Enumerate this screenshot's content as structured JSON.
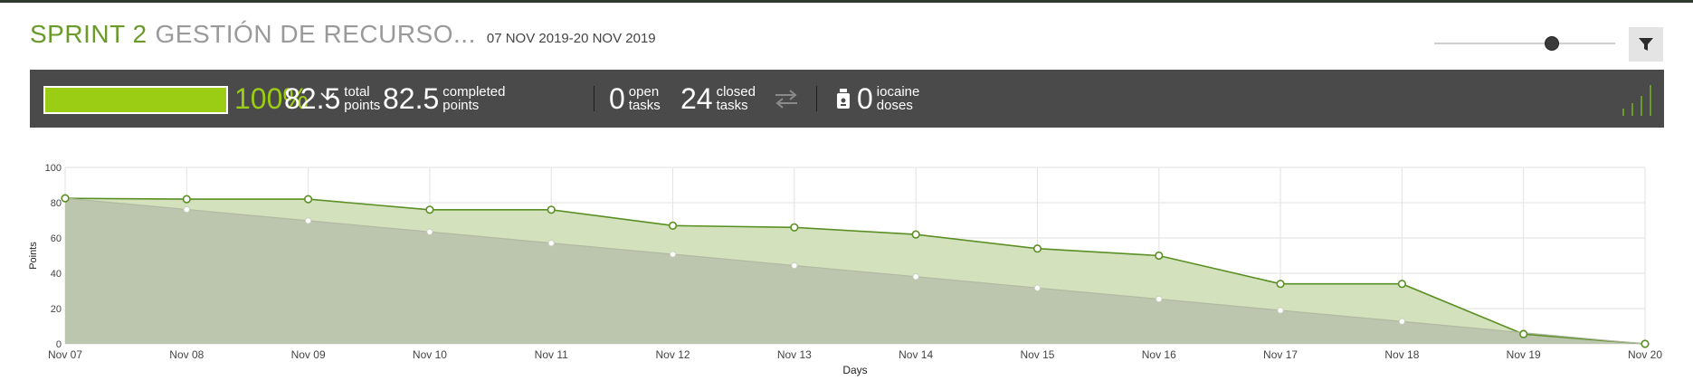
{
  "header": {
    "sprint_name": "SPRINT 2",
    "sprint_subtitle": "GESTIÓN DE RECURSO...",
    "dates": "07 NOV 2019-20 NOV 2019"
  },
  "controls": {
    "filter_icon": "funnel-icon",
    "zoom_slider_level": 0.78
  },
  "summary": {
    "progress_percent": 100,
    "percent_label": "100%",
    "total_points": "82.5",
    "total_points_label": [
      "total",
      "points"
    ],
    "completed_points": "82.5",
    "completed_points_label": [
      "completed",
      "points"
    ],
    "open_tasks": "0",
    "open_tasks_label": [
      "open",
      "tasks"
    ],
    "closed_tasks": "24",
    "closed_tasks_label": [
      "closed",
      "tasks"
    ],
    "iocaine_doses": "0",
    "iocaine_label": [
      "iocaine",
      "doses"
    ],
    "accent_color": "#9bcd14",
    "bar_background": "#4a4a4a"
  },
  "chart_data": {
    "type": "area",
    "x": [
      "Nov 07",
      "Nov 08",
      "Nov 09",
      "Nov 10",
      "Nov 11",
      "Nov 12",
      "Nov 13",
      "Nov 14",
      "Nov 15",
      "Nov 16",
      "Nov 17",
      "Nov 18",
      "Nov 19",
      "Nov 20"
    ],
    "series": [
      {
        "values": [
          82.5,
          82,
          82,
          76,
          76,
          67,
          66,
          62,
          54,
          50,
          34,
          34,
          5.5,
          0
        ],
        "color": "#5a8f24",
        "fill": "#d3e2bd"
      },
      {
        "values": [
          82.5,
          76.2,
          69.8,
          63.5,
          57.1,
          50.8,
          44.4,
          38.1,
          31.7,
          25.4,
          19,
          12.7,
          6.3,
          0
        ],
        "color": "#b2b9a2",
        "fill": "#bcc5ad"
      }
    ],
    "xlabel": "Days",
    "ylabel": "Points",
    "ylim": [
      0,
      100
    ],
    "yticks": [
      0,
      20,
      40,
      60,
      80,
      100
    ],
    "grid": true
  }
}
